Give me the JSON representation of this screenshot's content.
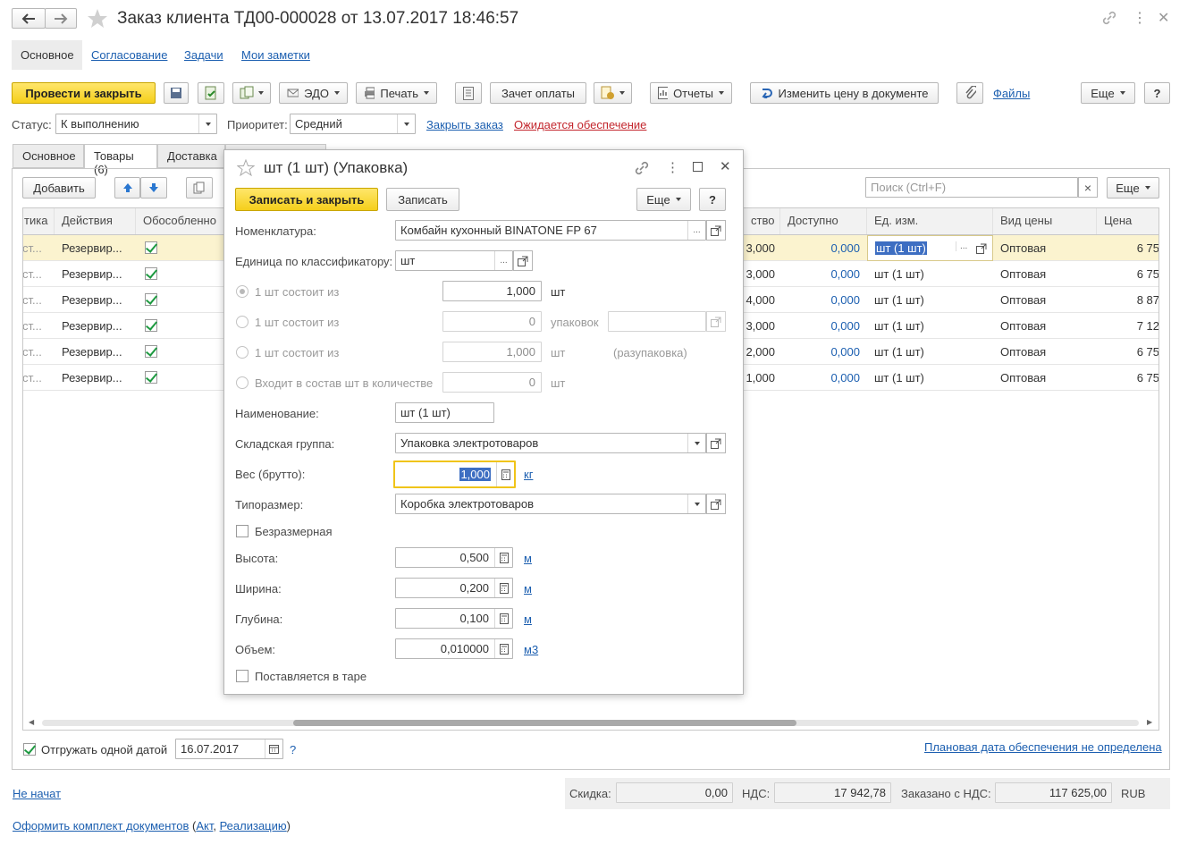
{
  "window": {
    "title": "Заказ клиента ТД00-000028 от 13.07.2017 18:46:57"
  },
  "nav": {
    "items": [
      "Основное",
      "Согласование",
      "Задачи",
      "Мои заметки"
    ]
  },
  "toolbar": {
    "post_close": "Провести и закрыть",
    "edo": "ЭДО",
    "print": "Печать",
    "payment_offset": "Зачет оплаты",
    "reports": "Отчеты",
    "change_price": "Изменить цену в документе",
    "files": "Файлы",
    "more": "Еще",
    "help": "?"
  },
  "status": {
    "status_label": "Статус:",
    "status_value": "К выполнению",
    "priority_label": "Приоритет:",
    "priority_value": "Средний",
    "close_order": "Закрыть заказ",
    "awaiting": "Ожидается обеспечение"
  },
  "tabs": [
    "Основное",
    "Товары (6)",
    "Доставка"
  ],
  "table_toolbar": {
    "add": "Добавить",
    "search_placeholder": "Поиск (Ctrl+F)",
    "search_clear": "×",
    "more": "Еще"
  },
  "table": {
    "columns_left": [
      "тика",
      "Действия",
      "Обособленно"
    ],
    "columns_right": [
      "ство",
      "Доступно",
      "Ед. изм.",
      "Вид цены",
      "Цена"
    ],
    "rows": [
      {
        "c0": "ст...",
        "action": "Резервир...",
        "separate": true,
        "qty": "3,000",
        "available": "0,000",
        "unit": "шт (1 шт)",
        "price_type": "Оптовая",
        "price": "6 75"
      },
      {
        "c0": "ст...",
        "action": "Резервир...",
        "separate": true,
        "qty": "3,000",
        "available": "0,000",
        "unit": "шт (1 шт)",
        "price_type": "Оптовая",
        "price": "6 75"
      },
      {
        "c0": "ст...",
        "action": "Резервир...",
        "separate": true,
        "qty": "4,000",
        "available": "0,000",
        "unit": "шт (1 шт)",
        "price_type": "Оптовая",
        "price": "8 87"
      },
      {
        "c0": "ст...",
        "action": "Резервир...",
        "separate": true,
        "qty": "3,000",
        "available": "0,000",
        "unit": "шт (1 шт)",
        "price_type": "Оптовая",
        "price": "7 12"
      },
      {
        "c0": "ст...",
        "action": "Резервир...",
        "separate": true,
        "qty": "2,000",
        "available": "0,000",
        "unit": "шт (1 шт)",
        "price_type": "Оптовая",
        "price": "6 75"
      },
      {
        "c0": "ст...",
        "action": "Резервир...",
        "separate": true,
        "qty": "1,000",
        "available": "0,000",
        "unit": "шт (1 шт)",
        "price_type": "Оптовая",
        "price": "6 75"
      }
    ]
  },
  "bottom": {
    "ship_one_date": "Отгружать одной датой",
    "ship_date": "16.07.2017",
    "help": "?",
    "plan_date": "Плановая дата обеспечения не определена",
    "not_started": "Не начат",
    "discount_label": "Скидка:",
    "discount_value": "0,00",
    "vat_label": "НДС:",
    "vat_value": "17 942,78",
    "ordered_label": "Заказано с НДС:",
    "ordered_value": "117 625,00",
    "currency": "RUB",
    "docs_prefix": "Оформить комплект документов",
    "docs_open": " (",
    "docs_act": "Акт",
    "docs_sep": ", ",
    "docs_realization": "Реализацию",
    "docs_close": ")"
  },
  "dialog": {
    "title": "шт (1 шт) (Упаковка)",
    "save_close": "Записать и закрыть",
    "save": "Записать",
    "more": "Еще",
    "help": "?",
    "nomenclature_label": "Номенклатура:",
    "nomenclature_value": "Комбайн кухонный BINATONE FP 67",
    "classifier_label": "Единица по классификатору:",
    "classifier_value": "шт",
    "opt1_label": "1 шт состоит из",
    "opt1_value": "1,000",
    "opt1_unit": "шт",
    "opt2_label": "1 шт состоит из",
    "opt2_value": "0",
    "opt2_unit": "упаковок",
    "opt3_label": "1 шт состоит из",
    "opt3_value": "1,000",
    "opt3_unit": "шт",
    "opt3_note": "(разупаковка)",
    "opt4_label": "Входит в состав шт в количестве",
    "opt4_value": "0",
    "opt4_unit": "шт",
    "name_label": "Наименование:",
    "name_value": "шт (1 шт)",
    "warehouse_label": "Складская группа:",
    "warehouse_value": "Упаковка электротоваров",
    "weight_label": "Вес (брутто):",
    "weight_value": "1,000",
    "weight_unit": "кг",
    "size_label": "Типоразмер:",
    "size_value": "Коробка электротоваров",
    "sizeless": "Безразмерная",
    "height_label": "Высота:",
    "height_value": "0,500",
    "height_unit": "м",
    "width_label": "Ширина:",
    "width_value": "0,200",
    "width_unit": "м",
    "depth_label": "Глубина:",
    "depth_value": "0,100",
    "depth_unit": "м",
    "volume_label": "Объем:",
    "volume_value": "0,010000",
    "volume_unit": "м3",
    "tare": "Поставляется в таре"
  },
  "colors": {
    "accent_yellow": "#f5cf1b",
    "link_blue": "#1c5fb0",
    "link_red": "#c3262d",
    "check_green": "#1e9a41",
    "selection": "#3d6ec2"
  }
}
